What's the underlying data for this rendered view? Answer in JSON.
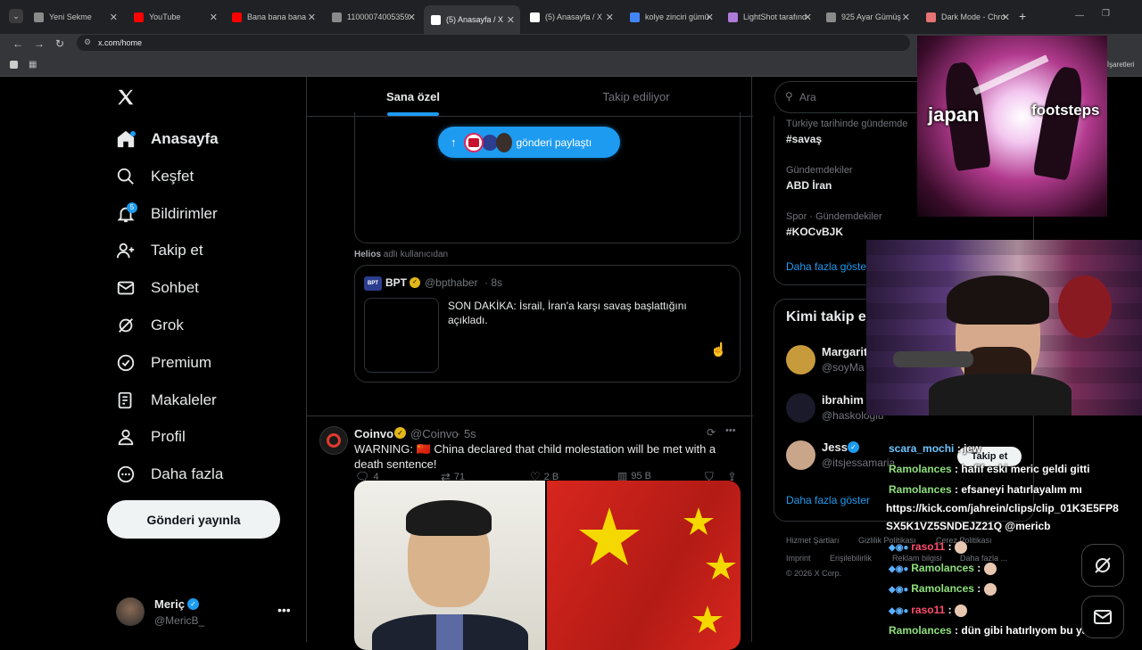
{
  "browser": {
    "tabs": [
      {
        "label": "Yeni Sekme",
        "color": "#8a8a8a"
      },
      {
        "label": "YouTube",
        "color": "#ff0000"
      },
      {
        "label": "Bana bana bana",
        "color": "#ff0000"
      },
      {
        "label": "11000074005359",
        "color": "#8a8a8a"
      },
      {
        "label": "(5) Anasayfa / X",
        "color": "#ffffff"
      },
      {
        "label": "(5) Anasayfa / X",
        "color": "#ffffff"
      },
      {
        "label": "kolye zinciri gümü",
        "color": "#4285f4"
      },
      {
        "label": "LightShot tarafınd",
        "color": "#b07ad9"
      },
      {
        "label": "925 Ayar Gümüş",
        "color": "#8a8a8a"
      },
      {
        "label": "Dark Mode - Chro",
        "color": "#e57373"
      }
    ],
    "url": "x.com/home",
    "bookmarks_right": "r İşaretleri"
  },
  "nav": {
    "items": [
      {
        "label": "Anasayfa",
        "icon": "home-icon"
      },
      {
        "label": "Keşfet",
        "icon": "search-icon"
      },
      {
        "label": "Bildirimler",
        "icon": "bell-icon",
        "badge": "5"
      },
      {
        "label": "Takip et",
        "icon": "follow-icon"
      },
      {
        "label": "Sohbet",
        "icon": "mail-icon"
      },
      {
        "label": "Grok",
        "icon": "grok-icon"
      },
      {
        "label": "Premium",
        "icon": "verified-icon"
      },
      {
        "label": "Makaleler",
        "icon": "article-icon"
      },
      {
        "label": "Profil",
        "icon": "profile-icon"
      },
      {
        "label": "Daha fazla",
        "icon": "more-icon"
      }
    ],
    "post_button": "Gönderi yayınla",
    "account": {
      "name": "Meriç",
      "handle": "@MericB_"
    }
  },
  "feed": {
    "tabs": [
      "Sana özel",
      "Takip ediliyor"
    ],
    "pill": "gönderi paylaştı",
    "repost_by_name": "Helios",
    "repost_by_suffix": "adlı kullanıcıdan",
    "quoted": {
      "name": "BPT",
      "handle": "@bpthaber",
      "time": "· 8s",
      "text": "SON DAKİKA: İsrail, İran'a karşı savaş başlattığını açıkladı."
    },
    "actions": {
      "replies": "4",
      "reposts": "71",
      "likes": "2 B",
      "views": "95 B"
    },
    "post2": {
      "name": "Coinvo",
      "handle": "@Coinvo",
      "time": "· 5s",
      "text": "WARNING: 🇨🇳 China declared that child molestation will be met with a death sentence!"
    }
  },
  "right": {
    "search_placeholder": "Ara",
    "trends": [
      {
        "label": "Türkiye tarihinde gündemde",
        "title": "#savaş"
      },
      {
        "label": "Gündemdekiler",
        "title": "ABD İran"
      },
      {
        "label": "Spor · Gündemdekiler",
        "title": "#KOCvBJK"
      }
    ],
    "show_more": "Daha fazla göster",
    "who_to_follow": "Kimi takip e",
    "follow": [
      {
        "name": "Margarit",
        "handle": "@soyMa"
      },
      {
        "name": "ibrahim",
        "handle": "@haskologlu"
      },
      {
        "name": "Jess",
        "handle": "@itsjessamaria"
      }
    ],
    "follow_button": "Takip et",
    "show_more2": "Daha fazla göster",
    "footer": [
      "Hizmet Şartları",
      "Gizlilik Politikası",
      "Çerez Politikası",
      "Imprint",
      "Erişilebilirlik",
      "Reklam bilgisi",
      "Daha fazla ...",
      "© 2026 X Corp."
    ]
  },
  "overlay": {
    "meme_left": "japan",
    "meme_right": "footsteps",
    "chat": [
      {
        "user": "scara_mochi",
        "text": "jew"
      },
      {
        "user": "Ramolances",
        "text": "hafif eski meric geldi gitti"
      },
      {
        "user": "Ramolances",
        "text": "efsaneyi hatırlayalım mı"
      },
      {
        "user": "",
        "text": "https://kick.com/jahrein/clips/clip_01K3E5FP8"
      },
      {
        "user": "",
        "text": "SX5K1VZ5SNDEJZ21Q @mericb"
      },
      {
        "user": "raso11",
        "text": ""
      },
      {
        "user": "Ramolances",
        "text": ""
      },
      {
        "user": "Ramolances",
        "text": ""
      },
      {
        "user": "raso11",
        "text": ""
      },
      {
        "user": "Ramolances",
        "text": "dün gibi hatırlıyom bu yayını"
      }
    ]
  }
}
